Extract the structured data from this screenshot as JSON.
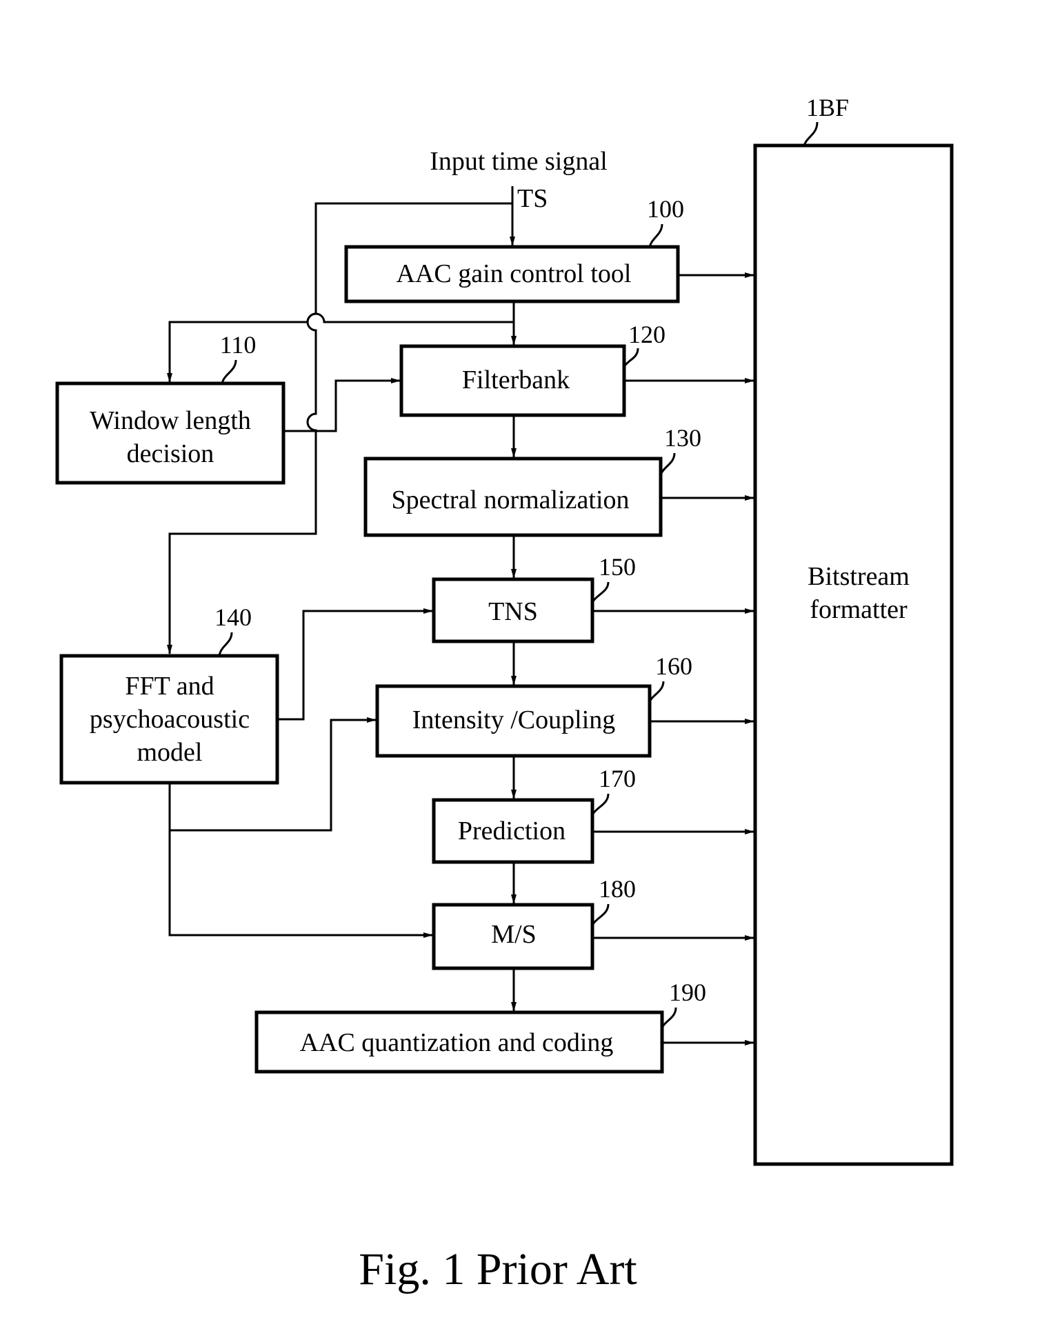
{
  "input": {
    "label": "Input time signal",
    "signal": "TS"
  },
  "blocks": {
    "gain": {
      "text": "AAC gain control tool",
      "ref": "100"
    },
    "window": {
      "line1": "Window length",
      "line2": "decision",
      "ref": "110"
    },
    "filterbank": {
      "text": "Filterbank",
      "ref": "120"
    },
    "spectral": {
      "text": "Spectral normalization",
      "ref": "130"
    },
    "fft": {
      "line1": "FFT and",
      "line2": "psychoacoustic",
      "line3": "model",
      "ref": "140"
    },
    "tns": {
      "text": "TNS",
      "ref": "150"
    },
    "intensity": {
      "text": "Intensity /Coupling",
      "ref": "160"
    },
    "prediction": {
      "text": "Prediction",
      "ref": "170"
    },
    "ms": {
      "text": "M/S",
      "ref": "180"
    },
    "quant": {
      "text": "AAC quantization and coding",
      "ref": "190"
    },
    "bitstream": {
      "line1": "Bitstream",
      "line2": "formatter",
      "ref": "1BF"
    }
  },
  "caption": "Fig. 1 Prior Art"
}
